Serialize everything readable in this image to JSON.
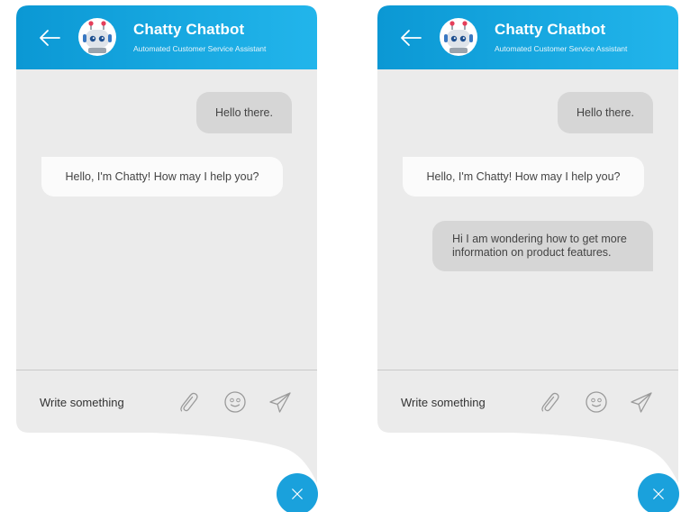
{
  "colors": {
    "header_gradient_start": "#0b9ad6",
    "header_gradient_end": "#20b4ea",
    "chat_background": "#ebebeb",
    "user_bubble": "#d6d6d6",
    "bot_bubble": "#fbfbfb",
    "accent": "#1aa1dc"
  },
  "panels": [
    {
      "header": {
        "title": "Chatty Chatbot",
        "subtitle": "Automated Customer Service Assistant"
      },
      "messages": [
        {
          "sender": "user",
          "text": "Hello there."
        },
        {
          "sender": "bot",
          "text": "Hello, I'm Chatty! How may I help you?"
        }
      ],
      "composer": {
        "placeholder": "Write something"
      }
    },
    {
      "header": {
        "title": "Chatty Chatbot",
        "subtitle": "Automated Customer Service Assistant"
      },
      "messages": [
        {
          "sender": "user",
          "text": "Hello there."
        },
        {
          "sender": "bot",
          "text": "Hello, I'm Chatty! How may I help you?"
        },
        {
          "sender": "user",
          "text": "Hi I am wondering how to get more information on product features."
        }
      ],
      "composer": {
        "placeholder": "Write something"
      }
    }
  ],
  "icons": {
    "back": "arrow-left-icon",
    "avatar": "robot-icon",
    "attach": "paperclip-icon",
    "emoji": "smiley-icon",
    "send": "paper-plane-icon",
    "close": "close-icon"
  }
}
